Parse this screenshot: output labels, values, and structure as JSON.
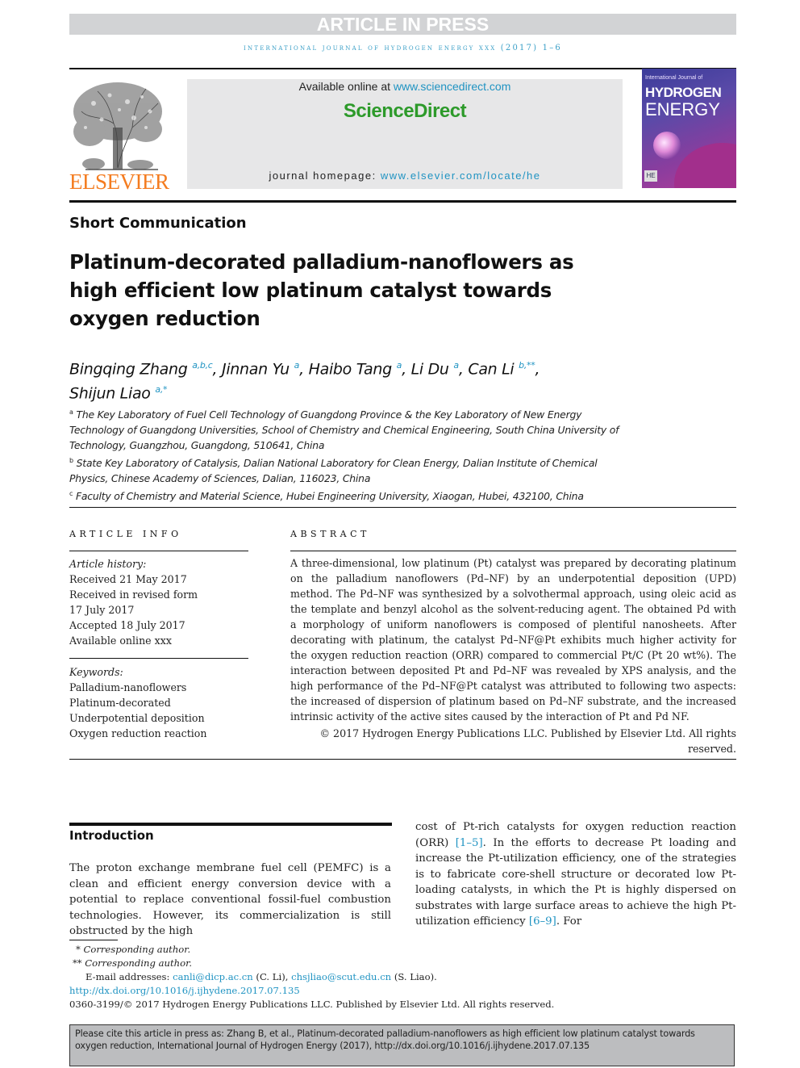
{
  "banner": {
    "status": "ARTICLE IN PRESS"
  },
  "journal_line": "INTERNATIONAL JOURNAL OF HYDROGEN ENERGY XXX (2017) 1–6",
  "header": {
    "publisher_logo_text": "ELSEVIER",
    "available_online_prefix": "Available online at ",
    "available_online_link": "www.sciencedirect.com",
    "brand": "ScienceDirect",
    "homepage_prefix": "journal homepage: ",
    "homepage_link": "www.elsevier.com/locate/he",
    "cover": {
      "subtitle": "International Journal of",
      "title_line1": "HYDROGEN",
      "title_line2": "ENERGY",
      "badge": "HE"
    }
  },
  "article": {
    "type": "Short Communication",
    "title": "Platinum-decorated palladium-nanoflowers as high efficient low platinum catalyst towards oxygen reduction",
    "authors": [
      {
        "name": "Bingqing Zhang",
        "sup": "a,b,c"
      },
      {
        "name": "Jinnan Yu",
        "sup": "a"
      },
      {
        "name": "Haibo Tang",
        "sup": "a"
      },
      {
        "name": "Li Du",
        "sup": "a"
      },
      {
        "name": "Can Li",
        "sup": "b,**"
      },
      {
        "name": "Shijun Liao",
        "sup": "a,*"
      }
    ],
    "affiliations": [
      {
        "label": "a",
        "text": "The Key Laboratory of Fuel Cell Technology of Guangdong Province & the Key Laboratory of New Energy Technology of Guangdong Universities, School of Chemistry and Chemical Engineering, South China University of Technology, Guangzhou, Guangdong, 510641, China"
      },
      {
        "label": "b",
        "text": "State Key Laboratory of Catalysis, Dalian National Laboratory for Clean Energy, Dalian Institute of Chemical Physics, Chinese Academy of Sciences, Dalian, 116023, China"
      },
      {
        "label": "c",
        "text": "Faculty of Chemistry and Material Science, Hubei Engineering University, Xiaogan, Hubei, 432100, China"
      }
    ]
  },
  "article_info": {
    "heading": "ARTICLE INFO",
    "history_label": "Article history:",
    "history": [
      "Received 21 May 2017",
      "Received in revised form",
      "17 July 2017",
      "Accepted 18 July 2017",
      "Available online xxx"
    ],
    "keywords_label": "Keywords:",
    "keywords": [
      "Palladium-nanoflowers",
      "Platinum-decorated",
      "Underpotential deposition",
      "Oxygen reduction reaction"
    ]
  },
  "abstract": {
    "heading": "ABSTRACT",
    "text": "A three-dimensional, low platinum (Pt) catalyst was prepared by decorating platinum on the palladium nanoflowers (Pd–NF) by an underpotential deposition (UPD) method. The Pd–NF was synthesized by a solvothermal approach, using oleic acid as the template and benzyl alcohol as the solvent-reducing agent. The obtained Pd with a morphology of uniform nanoflowers is composed of plentiful nanosheets. After decorating with platinum, the catalyst Pd–NF@Pt exhibits much higher activity for the oxygen reduction reaction (ORR) compared to commercial Pt/C (Pt 20 wt%). The interaction between deposited Pt and Pd–NF was revealed by XPS analysis, and the high performance of the Pd–NF@Pt catalyst was attributed to following two aspects: the increased of dispersion of platinum based on Pd–NF substrate, and the increased intrinsic activity of the active sites caused by the interaction of Pt and Pd NF.",
    "copyright": "© 2017 Hydrogen Energy Publications LLC. Published by Elsevier Ltd. All rights reserved."
  },
  "introduction": {
    "heading": "Introduction",
    "para1": "The proton exchange membrane fuel cell (PEMFC) is a clean and efficient energy conversion device with a potential to replace conventional fossil-fuel combustion technologies. However, its commercialization is still obstructed by the high",
    "para2_a": "cost of Pt-rich catalysts for oxygen reduction reaction (ORR) ",
    "ref1": "[1–5]",
    "para2_b": ". In the efforts to decrease Pt loading and increase the Pt-utilization efficiency, one of the strategies is to fabricate core-shell structure or decorated low Pt-loading catalysts, in which the Pt is highly dispersed on substrates with large surface areas to achieve the high Pt-utilization efficiency ",
    "ref2": "[6–9]",
    "para2_c": ". For"
  },
  "footnotes": {
    "corr1_mark": "*",
    "corr1": "Corresponding author.",
    "corr2_mark": "**",
    "corr2": "Corresponding author.",
    "email_label": "E-mail addresses: ",
    "email1": "canli@dicp.ac.cn",
    "email1_name": " (C. Li), ",
    "email2": "chsjliao@scut.edu.cn",
    "email2_name": " (S. Liao).",
    "doi": "http://dx.doi.org/10.1016/j.ijhydene.2017.07.135",
    "issn_copyright": "0360-3199/© 2017 Hydrogen Energy Publications LLC. Published by Elsevier Ltd. All rights reserved."
  },
  "cite_box": "Please cite this article in press as: Zhang B, et al., Platinum-decorated palladium-nanoflowers as high efficient low platinum catalyst towards oxygen reduction, International Journal of Hydrogen Energy (2017), http://dx.doi.org/10.1016/j.ijhydene.2017.07.135"
}
